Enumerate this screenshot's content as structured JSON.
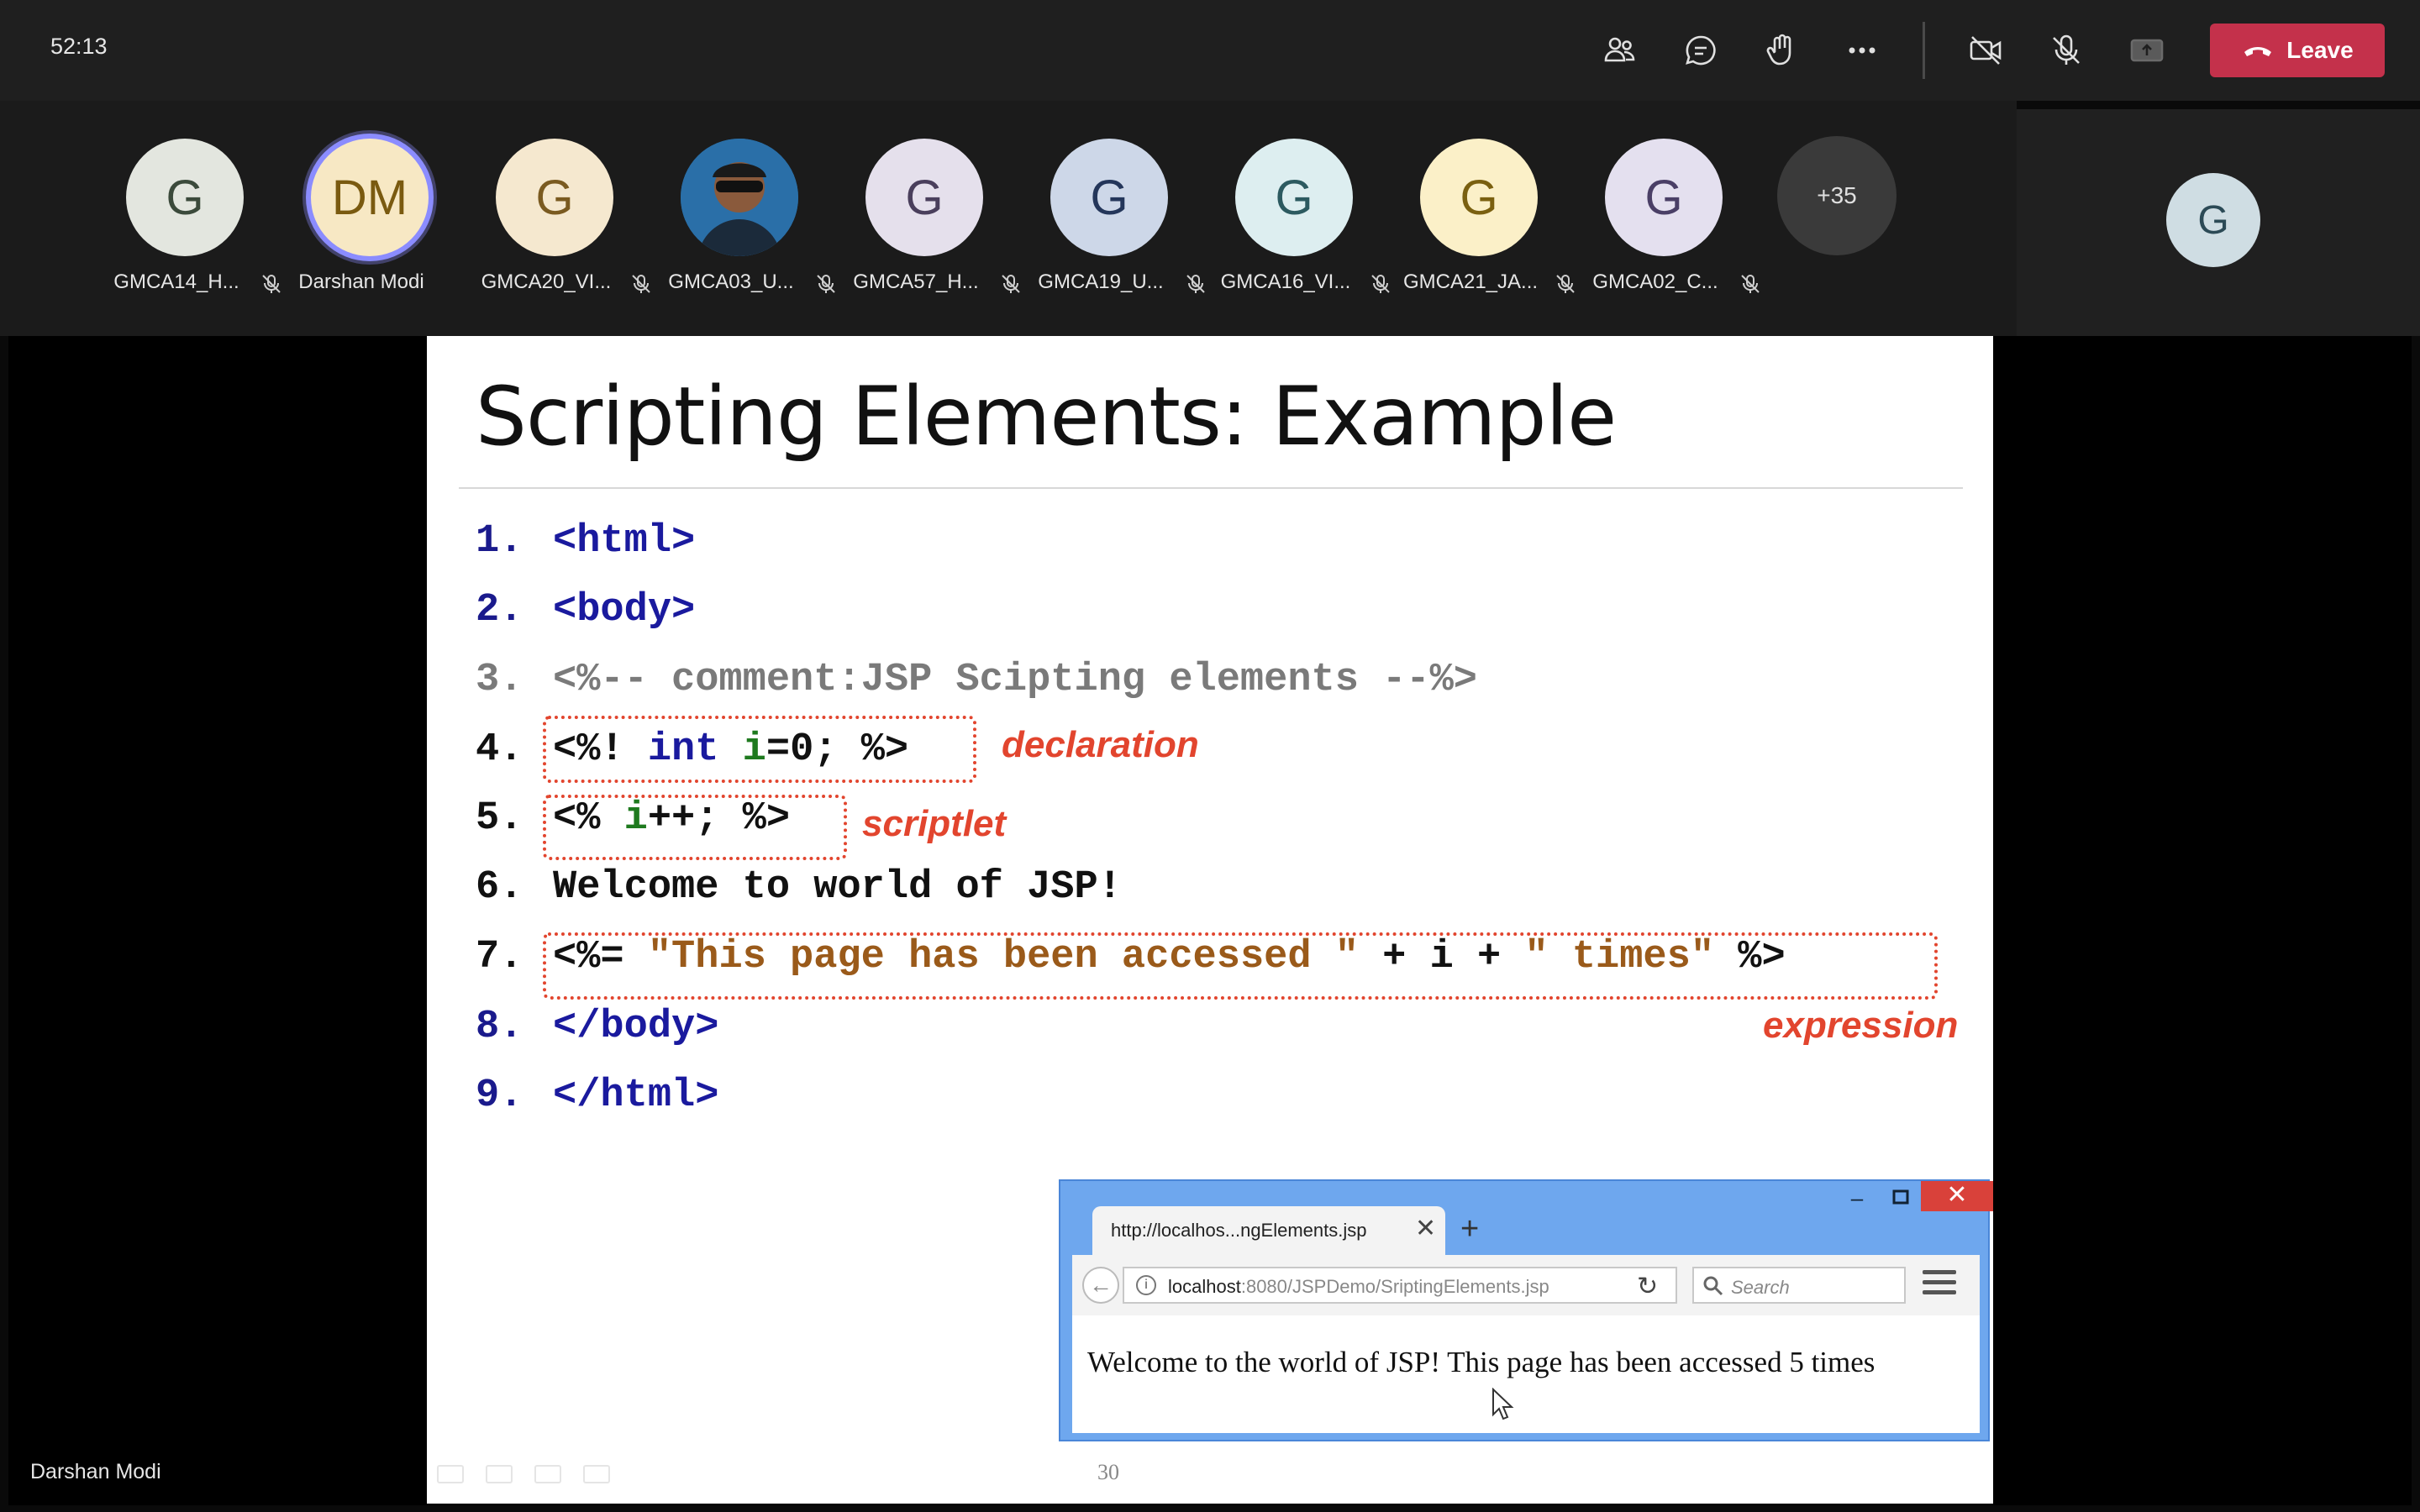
{
  "meeting": {
    "timer": "52:13",
    "leave_label": "Leave",
    "toolbar_icons": [
      "people-icon",
      "chat-icon",
      "raise-hand-icon",
      "more-icon",
      "camera-off-icon",
      "mic-off-icon",
      "share-icon"
    ]
  },
  "participants": [
    {
      "initial": "G",
      "name": "GMCA14_H...",
      "bg": "#e3e6df",
      "fg": "#3b4a3b"
    },
    {
      "initial": "DM",
      "name": "Darshan Modi",
      "bg": "#f7e8c4",
      "fg": "#7a5a10",
      "speaking": true
    },
    {
      "initial": "G",
      "name": "GMCA20_VI...",
      "bg": "#f5e8cf",
      "fg": "#7a5a20"
    },
    {
      "initial": "",
      "name": "GMCA03_U...",
      "bg": "#2a6fa8",
      "fg": "#ffffff",
      "photo": true
    },
    {
      "initial": "G",
      "name": "GMCA57_H...",
      "bg": "#e5e0ec",
      "fg": "#4a3f5c"
    },
    {
      "initial": "G",
      "name": "GMCA19_U...",
      "bg": "#cdd7e8",
      "fg": "#24365a"
    },
    {
      "initial": "G",
      "name": "GMCA16_VI...",
      "bg": "#ddeef0",
      "fg": "#2c5a60"
    },
    {
      "initial": "G",
      "name": "GMCA21_JA...",
      "bg": "#fbf0c8",
      "fg": "#7a6010"
    },
    {
      "initial": "G",
      "name": "GMCA02_C...",
      "bg": "#e4e0ef",
      "fg": "#4a3f66"
    }
  ],
  "overflow_count": "+35",
  "self_avatar": "G",
  "presenter_name": "Darshan Modi",
  "slide": {
    "title": "Scripting Elements: Example",
    "annotations": {
      "declaration": "declaration",
      "scriptlet": "scriptlet",
      "expression": "expression"
    },
    "page_number": "30",
    "lines": {
      "n1": "1.",
      "n2": "2.",
      "n3": "3.",
      "n4": "4.",
      "n5": "5.",
      "n6": "6.",
      "n7": "7.",
      "n8": "8.",
      "n9": "9.",
      "l1": "<html>",
      "l2": "<body>",
      "l3": "<%-- comment:JSP Scipting elements --%>",
      "l4a": "<%! ",
      "l4b": "int ",
      "l4c": "i",
      "l4d": "=0; %>",
      "l5a": "<% ",
      "l5b": "i",
      "l5c": "++; %>",
      "l6": "Welcome to world of JSP!",
      "l7a": "<%= ",
      "l7b": "\"This page has been accessed \"",
      "l7c": " + i + ",
      "l7d": "\" times\"",
      "l7e": " %>",
      "l8": "</body>",
      "l9": "</html>"
    }
  },
  "browser": {
    "tab_title": "http://localhos...ngElements.jsp",
    "url_host": "localhost",
    "url_rest": ":8080/JSPDemo/SriptingElements.jsp",
    "search_placeholder": "Search",
    "output": "Welcome to the world of JSP! This page has been accessed 5 times"
  }
}
